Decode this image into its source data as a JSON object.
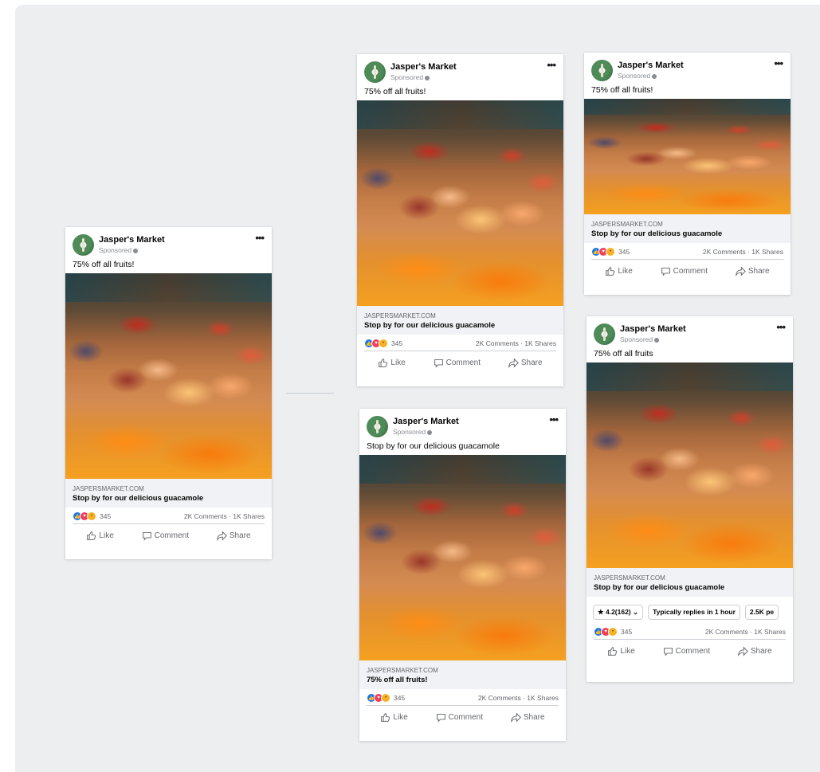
{
  "posts": [
    {
      "id": "main",
      "page_name": "Jasper's Market",
      "sponsored": "Sponsored",
      "text": "75% off all fruits!",
      "domain": "JASPERSMARKET.COM",
      "headline": "Stop by for our delicious guacamole",
      "reaction_count": "345",
      "comments_shares": "2K Comments · 1K Shares"
    },
    {
      "id": "top-middle",
      "page_name": "Jasper's Market",
      "sponsored": "Sponsored",
      "text": "75% off all fruits!",
      "domain": "JASPERSMARKET.COM",
      "headline": "Stop by for our delicious guacamole",
      "reaction_count": "345",
      "comments_shares": "2K Comments · 1K Shares"
    },
    {
      "id": "top-right",
      "page_name": "Jasper's Market",
      "sponsored": "Sponsored",
      "text": "75% off all fruits!",
      "domain": "JASPERSMARKET.COM",
      "headline": "Stop by for our delicious guacamole",
      "reaction_count": "345",
      "comments_shares": "2K Comments · 1K Shares"
    },
    {
      "id": "bottom-middle",
      "page_name": "Jasper's Market",
      "sponsored": "Sponsored",
      "text": "Stop by for our delicious guacamole",
      "domain": "JASPERSMARKET.COM",
      "headline": "75% off all fruits!",
      "reaction_count": "345",
      "comments_shares": "2K Comments · 1K Shares"
    },
    {
      "id": "bottom-right",
      "page_name": "Jasper's Market",
      "sponsored": "Sponsored",
      "text": "75% off all fruits",
      "domain": "JASPERSMARKET.COM",
      "headline": "Stop by for our delicious guacamole",
      "reaction_count": "345",
      "comments_shares": "2K Comments · 1K Shares",
      "pills": [
        "★ 4.2(162) ⌄",
        "Typically replies in 1 hour",
        "2.5K pe"
      ]
    }
  ],
  "actions": {
    "like": "Like",
    "comment": "Comment",
    "share": "Share"
  },
  "icons": {
    "more": "more-options-icon",
    "like": "thumbs-up-icon",
    "comment": "comment-bubble-icon",
    "share": "share-arrow-icon",
    "globe": "globe-icon"
  },
  "colors": {
    "like": "#1877f2",
    "love": "#f33e58",
    "wow": "#f7b125",
    "canvas": "#eceef0"
  }
}
